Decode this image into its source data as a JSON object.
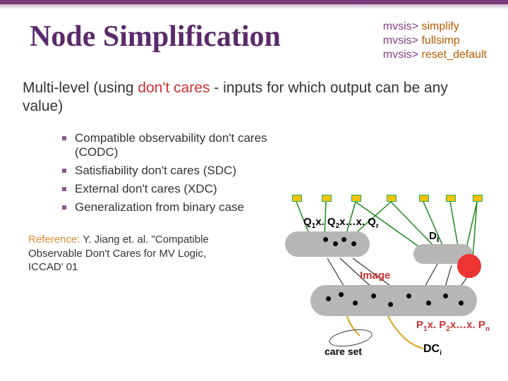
{
  "title": "Node Simplification",
  "commands": {
    "c1": {
      "prompt": "mvsis>",
      "cmd": "simplify"
    },
    "c2": {
      "prompt": "mvsis>",
      "cmd": "fullsimp"
    },
    "c3": {
      "prompt": "mvsis>",
      "cmd": "reset_default"
    }
  },
  "subhead": {
    "pre": "Multi-level (using ",
    "hi": "don't cares",
    "post": " - inputs for which output can be any value)"
  },
  "bullets": {
    "b1": "Compatible observability don't cares (CODC)",
    "b2": "Satisfiability don't cares (SDC)",
    "b3": "External don't cares (XDC)",
    "b4": "Generalization from binary case"
  },
  "reference": {
    "label": "Reference:",
    "text": " Y. Jiang et. al. \"Compatible Observable Don't Cares for MV Logic, ICCAD' 01"
  },
  "labels": {
    "q": "Q",
    "qexpr": "x. Q",
    "qtail": "x…x. Q",
    "sub1": "1",
    "sub2": "2",
    "subr": "r",
    "di": "D",
    "subi": "i",
    "image": "Image",
    "p": "P",
    "pexpr": "x. P",
    "ptail": "x…x. P",
    "subn": "n",
    "careset": "care set",
    "dc": "DC"
  }
}
